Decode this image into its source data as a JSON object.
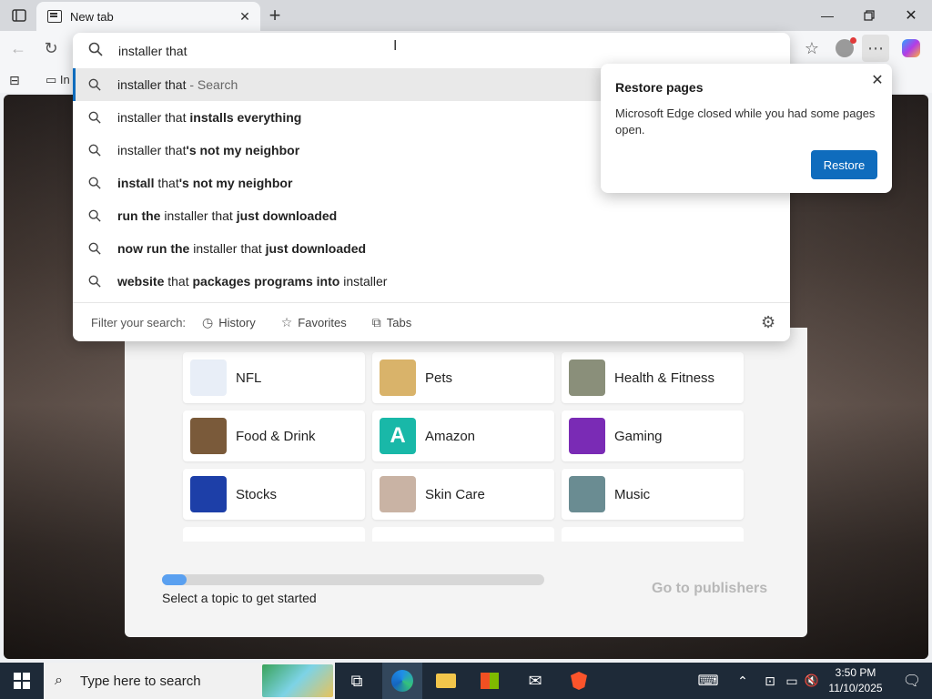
{
  "browser": {
    "tab_title": "New tab",
    "bookmark_partial": "In"
  },
  "address": {
    "value": "installer that"
  },
  "suggestions": [
    {
      "parts": [
        {
          "t": "installer that",
          "b": false
        },
        {
          "t": " - Search",
          "b": false,
          "muted": true
        }
      ]
    },
    {
      "parts": [
        {
          "t": "installer that ",
          "b": false
        },
        {
          "t": "installs everything",
          "b": true
        }
      ]
    },
    {
      "parts": [
        {
          "t": "installer that",
          "b": false
        },
        {
          "t": "'s not my neighbor",
          "b": true
        }
      ]
    },
    {
      "parts": [
        {
          "t": "install",
          "b": true
        },
        {
          "t": " that",
          "b": false
        },
        {
          "t": "'s not my neighbor",
          "b": true
        }
      ]
    },
    {
      "parts": [
        {
          "t": "run the",
          "b": true
        },
        {
          "t": " installer that ",
          "b": false
        },
        {
          "t": "just downloaded",
          "b": true
        }
      ]
    },
    {
      "parts": [
        {
          "t": "now run the",
          "b": true
        },
        {
          "t": " installer that ",
          "b": false
        },
        {
          "t": "just downloaded",
          "b": true
        }
      ]
    },
    {
      "parts": [
        {
          "t": "website",
          "b": true
        },
        {
          "t": " that ",
          "b": false
        },
        {
          "t": "packages programs into",
          "b": true
        },
        {
          "t": " installer",
          "b": false
        }
      ]
    }
  ],
  "filter": {
    "label": "Filter your search:",
    "history": "History",
    "favorites": "Favorites",
    "tabs": "Tabs"
  },
  "restore": {
    "title": "Restore pages",
    "message": "Microsoft Edge closed while you had some pages open.",
    "button": "Restore"
  },
  "topics": [
    {
      "label": "NFL",
      "color": "#e8eef7"
    },
    {
      "label": "Pets",
      "color": "#d9b36a"
    },
    {
      "label": "Health & Fitness",
      "color": "#8a8f7a"
    },
    {
      "label": "Food & Drink",
      "color": "#7a5a3a"
    },
    {
      "label": "Amazon",
      "color": "#19b8a8"
    },
    {
      "label": "Gaming",
      "color": "#7a2bb5"
    },
    {
      "label": "Stocks",
      "color": "#1d3fa8"
    },
    {
      "label": "Skin Care",
      "color": "#c9b3a4"
    },
    {
      "label": "Music",
      "color": "#6a8c92"
    }
  ],
  "progress": {
    "fraction": 0.065,
    "text": "Select a topic to get started"
  },
  "publishers_link": "Go to publishers",
  "taskbar": {
    "search_placeholder": "Type here to search",
    "time": "3:50 PM",
    "date": "11/10/2025"
  },
  "colors": {
    "accent": "#0f6cbd",
    "taskbar": "#1e2a38"
  }
}
